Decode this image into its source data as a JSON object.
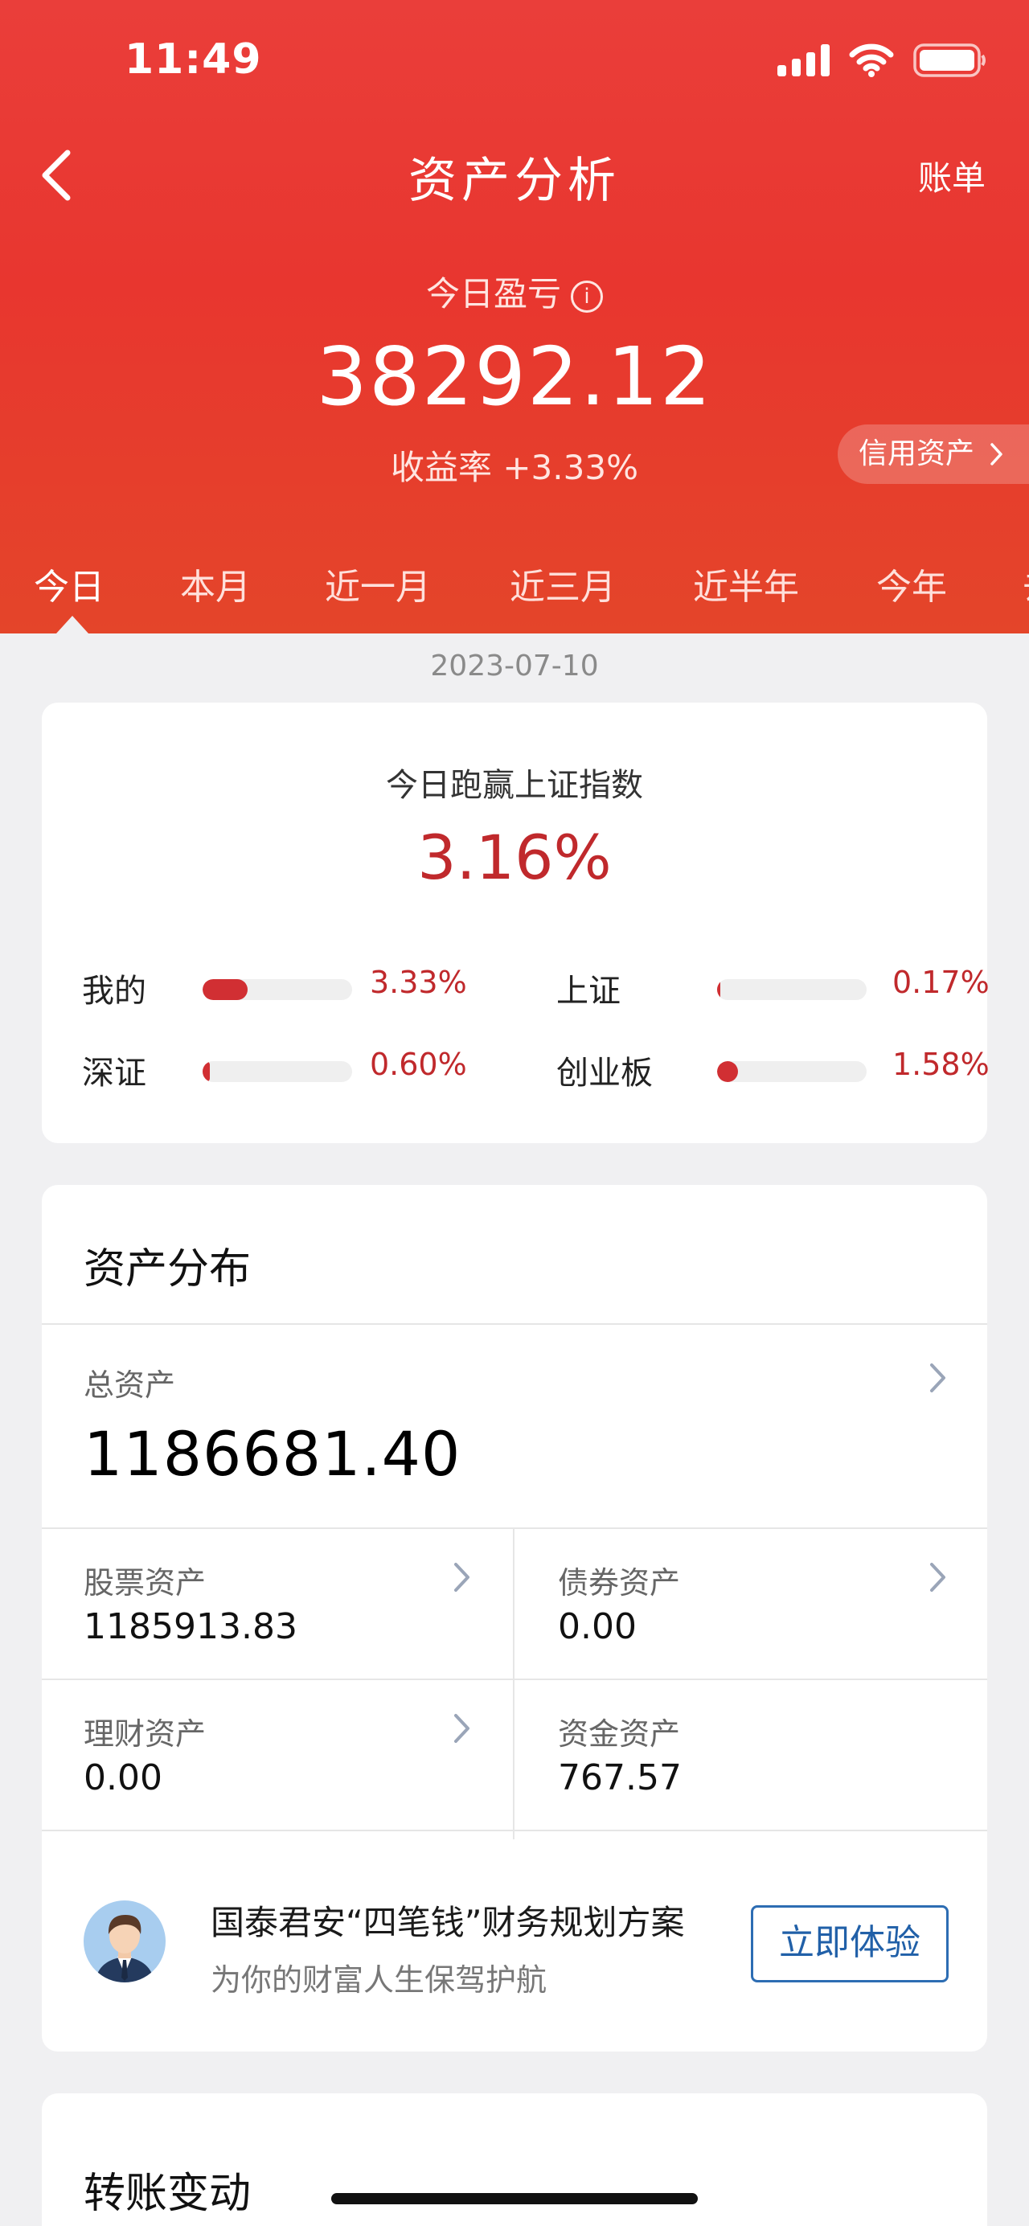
{
  "status_bar": {
    "time": "11:49"
  },
  "nav": {
    "title": "资产分析",
    "bill": "账单"
  },
  "summary": {
    "pnl_label": "今日盈亏",
    "info_glyph": "i",
    "pnl_value": "38292.12",
    "yield_text": "收益率 +3.33%",
    "credit_button": "信用资产"
  },
  "tabs": [
    {
      "label": "今日",
      "active": true
    },
    {
      "label": "本月"
    },
    {
      "label": "近一月"
    },
    {
      "label": "近三月"
    },
    {
      "label": "近半年"
    },
    {
      "label": "今年"
    },
    {
      "label": "去"
    }
  ],
  "date": "2023-07-10",
  "beat": {
    "title": "今日跑赢上证指数",
    "value": "3.16%",
    "items": [
      {
        "label": "我的",
        "value": "3.33%",
        "bar_fraction": 0.3
      },
      {
        "label": "上证",
        "value": "0.17%",
        "bar_fraction": 0.02
      },
      {
        "label": "深证",
        "value": "0.60%",
        "bar_fraction": 0.05
      },
      {
        "label": "创业板",
        "value": "1.58%",
        "bar_fraction": 0.14
      }
    ]
  },
  "assets": {
    "title": "资产分布",
    "total_label": "总资产",
    "total_value": "1186681.40",
    "stock_label": "股票资产",
    "stock_value": "1185913.83",
    "bond_label": "债券资产",
    "bond_value": "0.00",
    "wealth_label": "理财资产",
    "wealth_value": "0.00",
    "cash_label": "资金资产",
    "cash_value": "767.57"
  },
  "promo": {
    "title": "国泰君安“四笔钱”财务规划方案",
    "subtitle": "为你的财富人生保驾护航",
    "button": "立即体验"
  },
  "transfer": {
    "title": "转账变动"
  },
  "colors": {
    "header_red": "#e8362f",
    "gain_red": "#c0292c",
    "button_blue": "#2d6db3"
  }
}
